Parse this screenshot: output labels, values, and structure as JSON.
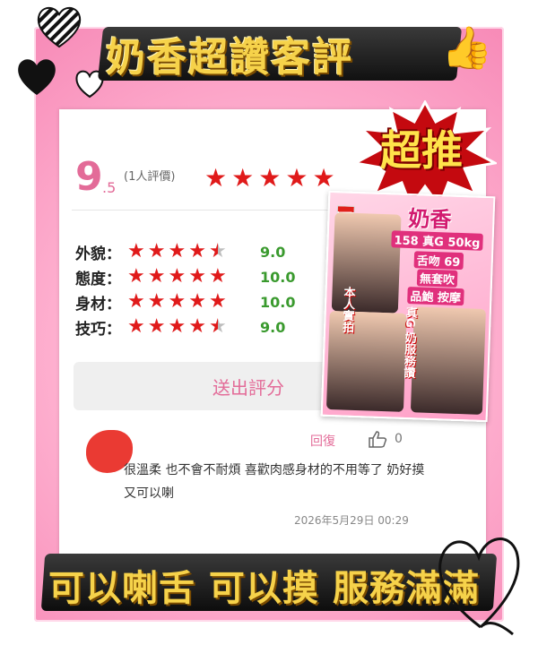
{
  "title": "奶香超讚客評",
  "burst_label": "超推",
  "summary": {
    "score_main": "9",
    "score_decimal": ".5",
    "review_count": "(1人評價)",
    "stars": 5
  },
  "ratings": [
    {
      "label": "外貌：",
      "value": "9.0",
      "stars": 4.5
    },
    {
      "label": "態度：",
      "value": "10.0",
      "stars": 5
    },
    {
      "label": "身材：",
      "value": "10.0",
      "stars": 5
    },
    {
      "label": "技巧：",
      "value": "9.0",
      "stars": 4.5
    }
  ],
  "submit_button": "送出評分",
  "comment": {
    "reply_label": "回復",
    "like_count": "0",
    "text": "很溫柔 也不會不耐煩 喜歡肉感身材的不用等了 奶好摸又可以喇",
    "timestamp": "2026年5月29日 00:29"
  },
  "promo": {
    "name": "奶香",
    "stats": "158 真G 50kg",
    "line1": "舌吻 69",
    "line2": "無套吹",
    "line3": "品鮑 按摩",
    "vertical_left": "本人實拍",
    "vertical_right": "真G 奶服務讚"
  },
  "bottom_banner": "可以喇舌 可以摸 服務滿滿",
  "colors": {
    "accent": "#e36b98",
    "star": "#e01a1a",
    "value_green": "#3a9a2e"
  }
}
